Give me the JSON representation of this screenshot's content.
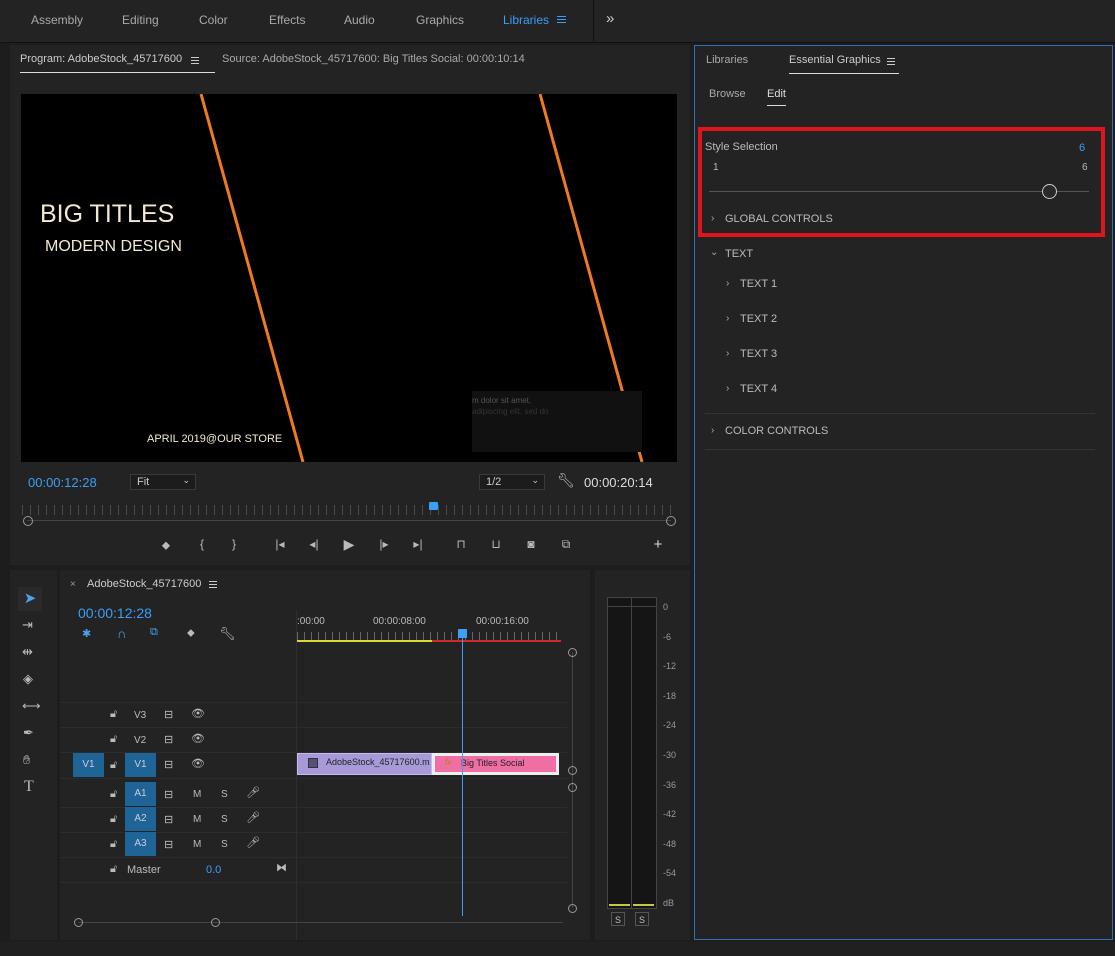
{
  "workspaces": {
    "tabs": [
      "Assembly",
      "Editing",
      "Color",
      "Effects",
      "Audio",
      "Graphics",
      "Libraries"
    ],
    "active": "Libraries"
  },
  "program": {
    "tab_label": "Program: AdobeStock_45717600",
    "source_label": "Source: AdobeStock_45717600: Big Titles Social: 00:00:10:14",
    "video": {
      "title": "BIG TITLES",
      "subtitle": "MODERN DESIGN",
      "footer": "APRIL 2019@OUR STORE",
      "ghost_line1": "m dolor sit amet,",
      "ghost_line2": "adipiscing elit, sed do"
    },
    "current_time": "00:00:12:28",
    "zoom_value": "Fit",
    "resolution_value": "1/2",
    "duration": "00:00:20:14",
    "playhead_fraction": 0.63
  },
  "essential_graphics": {
    "tab_libraries": "Libraries",
    "tab_essential": "Essential Graphics",
    "subtab_browse": "Browse",
    "subtab_edit": "Edit",
    "style_selection": {
      "label": "Style Selection",
      "value": "6",
      "min": "1",
      "max": "6",
      "slider_fraction": 1.0
    },
    "sections": {
      "global_controls": "GLOBAL CONTROLS",
      "text": "TEXT",
      "text_items": [
        "TEXT 1",
        "TEXT 2",
        "TEXT 3",
        "TEXT 4"
      ],
      "color_controls": "COLOR CONTROLS"
    },
    "highlight_color": "#e0141d"
  },
  "timeline": {
    "sequence_name": "AdobeStock_45717600",
    "current_time": "00:00:12:28",
    "ruler_ticks": [
      ":00:00",
      "00:00:08:00",
      "00:00:16:00"
    ],
    "tracks": {
      "v3": "V3",
      "v2": "V2",
      "v1": "V1",
      "v1_source": "V1",
      "a1": "A1",
      "a2": "A2",
      "a3": "A3",
      "mute": "M",
      "solo": "S",
      "master_label": "Master",
      "master_value": "0.0"
    },
    "clips": {
      "video_clip": "AdobeStock_45717600.m",
      "graphic_clip": "Big Titles Social"
    }
  },
  "audio_meter": {
    "scale": [
      "0",
      "-6",
      "-12",
      "-18",
      "-24",
      "-30",
      "-36",
      "-42",
      "-48",
      "-54",
      "dB"
    ],
    "solo_left": "S",
    "solo_right": "S"
  }
}
